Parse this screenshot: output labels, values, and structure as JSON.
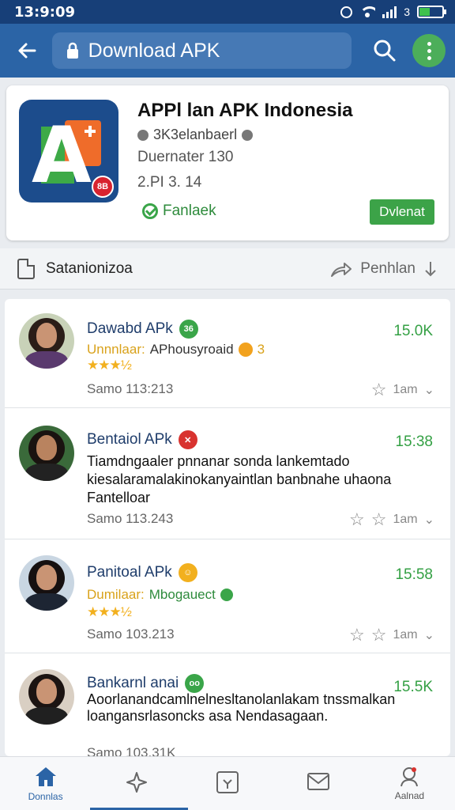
{
  "status_bar": {
    "time": "13:9:09",
    "battery_text": "3"
  },
  "app_bar": {
    "url_title": "Download APK"
  },
  "app_card": {
    "title": "APPl lan APK Indonesia",
    "icon_letter": "A",
    "icon_badge": "8B",
    "developer": "3K3elanbaerl",
    "meta_line1": "Duernater 130",
    "meta_line2": "2.PI 3. 14",
    "verified_label": "Fanlaek",
    "install_label": "Dvlenat"
  },
  "action_row": {
    "left_label": "Satanionizoa",
    "right_label": "Penhlan"
  },
  "items": [
    {
      "title": "Dawabd APk",
      "emoji_text": "36",
      "emoji_color": "#3aa549",
      "size": "15.0K",
      "sub_label": "Unnnlaar:",
      "sub_value": "APhousyroaid",
      "sub_extra": "3",
      "stars": "★★★½",
      "description": "",
      "date": "Samo  113:213",
      "action_text": "1am"
    },
    {
      "title": "Bentaiol APk",
      "emoji_text": "✕",
      "emoji_color": "#d8332f",
      "size": "15:38",
      "sub_label": "",
      "sub_value": "",
      "sub_extra": "",
      "stars": "",
      "description": "Tiamdngaaler pnnanar sonda lankemtado kiesalaramalakinokanyaintlan banbnahe uhaona Fantelloar",
      "date": "Samo  113.243",
      "action_text": "1am"
    },
    {
      "title": "Panitoal APk",
      "emoji_text": "☺",
      "emoji_color": "#f2b01e",
      "size": "15:58",
      "sub_label": "Dumilaar:",
      "sub_value": "Mbogauect",
      "sub_extra": "",
      "stars": "★★★½",
      "description": "",
      "date": "Samo  103.213",
      "action_text": "1am"
    },
    {
      "title": "Bankarnl anai",
      "emoji_text": "oo",
      "emoji_color": "#3aa549",
      "size": "15.5K",
      "sub_label": "",
      "sub_value": "",
      "sub_extra": "",
      "stars": "",
      "description": "Aoorlanandcamlnelnesltanolanlakam tnssmalkan loangansrlasoncks asa Nendasagaan.",
      "date": "Samo  103.31K",
      "action_text": ""
    }
  ],
  "bottom_nav": [
    {
      "label": "Donnlas",
      "icon": "home-icon",
      "active": true
    },
    {
      "label": "",
      "icon": "sparkle-icon",
      "active": false
    },
    {
      "label": "",
      "icon": "apps-icon",
      "active": false
    },
    {
      "label": "",
      "icon": "mail-icon",
      "active": false
    },
    {
      "label": "Aalnad",
      "icon": "profile-icon",
      "active": false
    }
  ],
  "colors": {
    "app_bar": "#2b64a6",
    "status_bar": "#173f78",
    "accent_green": "#3ca348",
    "link_blue": "#1f3d6b",
    "star_yellow": "#f2b01e"
  }
}
